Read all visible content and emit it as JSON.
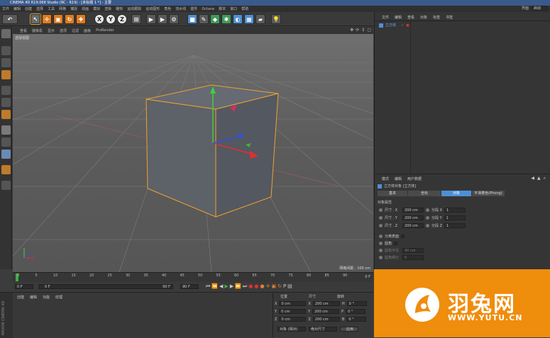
{
  "window": {
    "title": "CINEMA 4D R19.068 Studio (RC - R19) - [未标题 1 *] - 主要"
  },
  "menubar": {
    "items": [
      "文件",
      "编辑",
      "创建",
      "选择",
      "工具",
      "网格",
      "捕捉",
      "动画",
      "模拟",
      "渲染",
      "雕刻",
      "运动跟踪",
      "运动图形",
      "角色",
      "流水线",
      "插件",
      "Octane",
      "脚本",
      "窗口",
      "帮助"
    ],
    "right_label": "界面",
    "right_value": "启动"
  },
  "viewport": {
    "menu": [
      "查看",
      "摄像机",
      "显示",
      "选项",
      "过滤",
      "面板",
      "ProRender"
    ],
    "view_label": "透视视图",
    "grid_spacing": "网格间距 : 100 cm"
  },
  "timeline": {
    "ticks": [
      "0",
      "5",
      "10",
      "15",
      "20",
      "25",
      "30",
      "35",
      "40",
      "45",
      "50",
      "55",
      "60",
      "65",
      "70",
      "75",
      "80",
      "85",
      "90"
    ],
    "end_frame_label": "0 F"
  },
  "playbar": {
    "current_frame": "0 F",
    "start_frame": "0 F",
    "range_end": "90 F",
    "end_frame": "90 F"
  },
  "materials": {
    "menu": [
      "创建",
      "编辑",
      "功能",
      "纹理"
    ],
    "side_logo": "MAXON CINEMA 4D"
  },
  "coordinates": {
    "headers": [
      "位置",
      "尺寸",
      "旋转"
    ],
    "rows": [
      {
        "axis": "X",
        "pos": "0 cm",
        "size": "200 cm",
        "rot_axis": "H",
        "rot": "0 °"
      },
      {
        "axis": "Y",
        "pos": "0 cm",
        "size": "200 cm",
        "rot_axis": "P",
        "rot": "0 °"
      },
      {
        "axis": "Z",
        "pos": "0 cm",
        "size": "200 cm",
        "rot_axis": "B",
        "rot": "0 °"
      }
    ],
    "mode_select": "对象 (相对)",
    "size_select": "绝对尺寸",
    "apply_label": "应用"
  },
  "object_manager": {
    "menu": [
      "文件",
      "编辑",
      "查看",
      "对象",
      "标签",
      "书签"
    ],
    "objects": [
      {
        "name": "立方体"
      }
    ]
  },
  "attribute_manager": {
    "menu": [
      "模式",
      "编辑",
      "用户数据"
    ],
    "object_title": "立方体对象 [立方体]",
    "tabs": [
      "基本",
      "坐标",
      "对象",
      "平滑着色(Phong)"
    ],
    "active_tab": "对象",
    "section_title": "对象属性",
    "params": [
      {
        "label": "尺寸 . X",
        "value": "200 cm",
        "seg_label": "分段 X",
        "seg_value": "1"
      },
      {
        "label": "尺寸 . Y",
        "value": "200 cm",
        "seg_label": "分段 Y",
        "seg_value": "1"
      },
      {
        "label": "尺寸 . Z",
        "value": "200 cm",
        "seg_label": "分段 Z",
        "seg_value": "1"
      }
    ],
    "separate_surfaces": "分离表面",
    "fillet": "圆角",
    "fillet_radius_label": "圆角半径",
    "fillet_radius_value": "40 cm",
    "fillet_subdiv_label": "圆角细分",
    "fillet_subdiv_value": "5"
  },
  "watermark": {
    "brand": "羽兔网",
    "url": "WWW.YUTU.CN"
  },
  "colors": {
    "accent": "#4e8fd6",
    "selection": "#f0a030",
    "logo_bg": "#ef8d0c"
  }
}
